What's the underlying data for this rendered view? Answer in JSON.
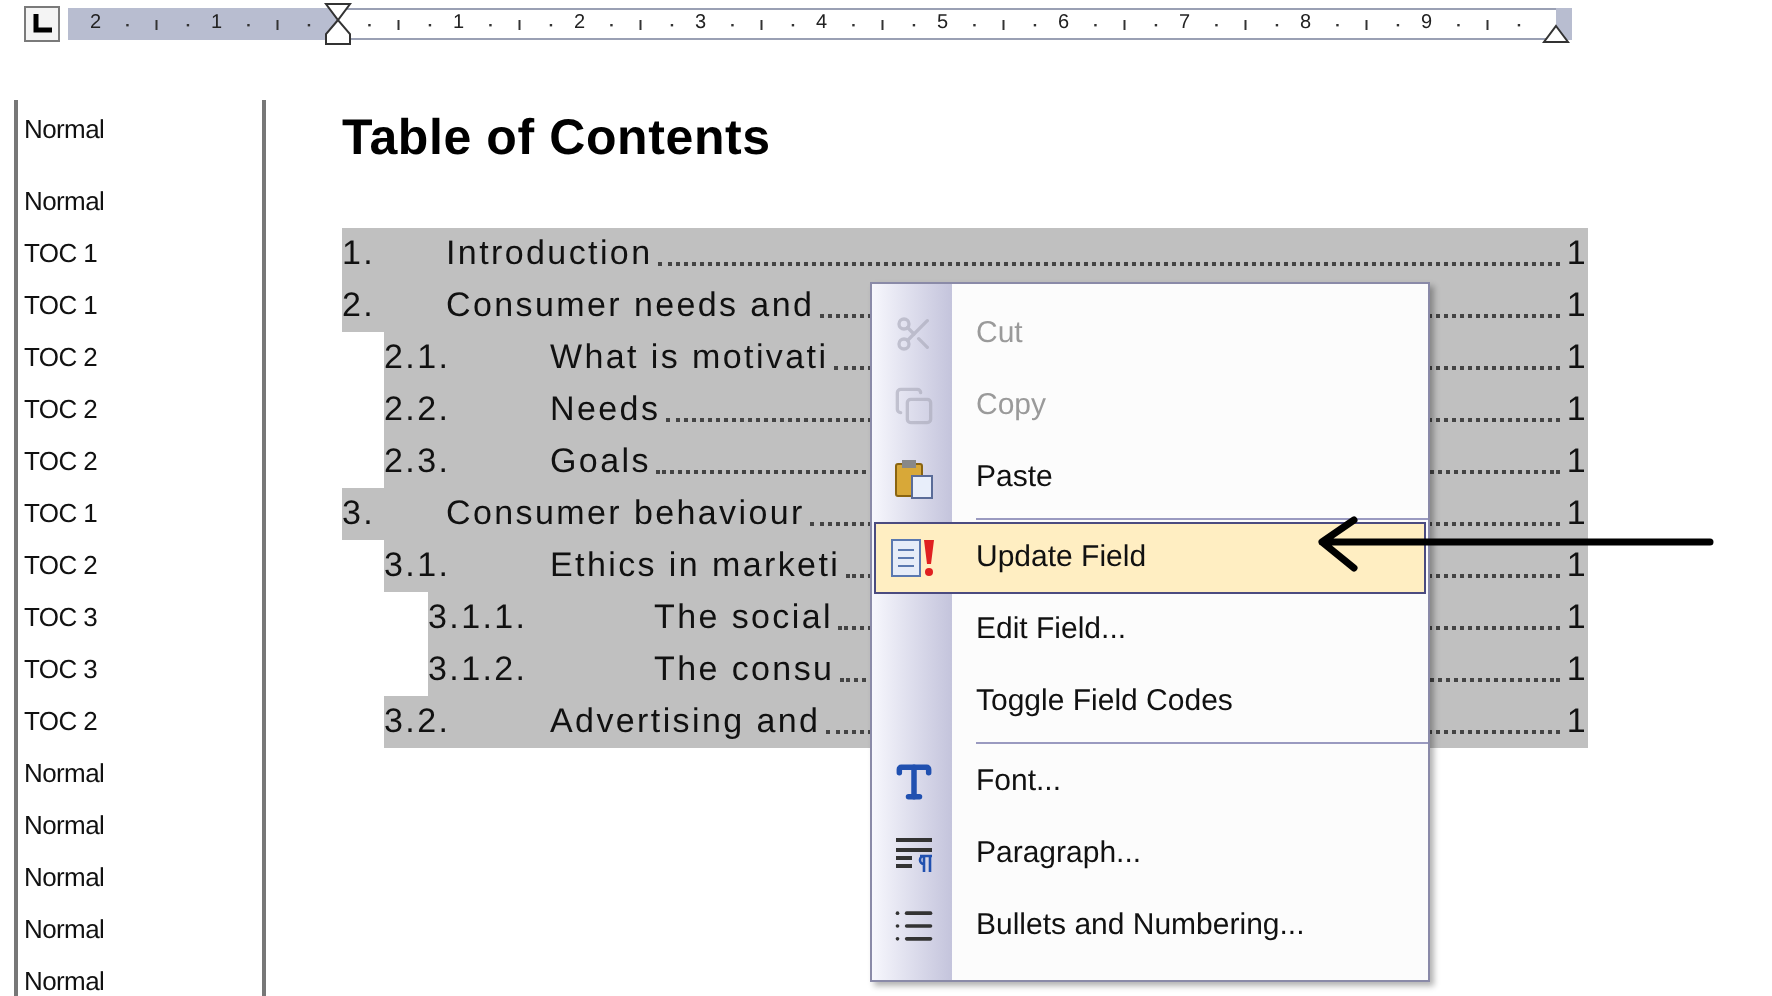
{
  "ruler": {
    "labels": [
      "2",
      "1",
      "1",
      "2",
      "3",
      "4",
      "5",
      "6",
      "7",
      "8",
      "9"
    ]
  },
  "style_area": {
    "items": [
      "Normal",
      "Normal",
      "TOC 1",
      "TOC 1",
      "TOC 2",
      "TOC 2",
      "TOC 2",
      "TOC 1",
      "TOC 2",
      "TOC 3",
      "TOC 3",
      "TOC 2",
      "Normal",
      "Normal",
      "Normal",
      "Normal",
      "Normal"
    ]
  },
  "document": {
    "title": "Table of Contents",
    "toc": [
      {
        "number": "1.",
        "text": "Introduction",
        "page": "1"
      },
      {
        "number": "2.",
        "text": "Consumer needs and",
        "page": "1",
        "children": [
          {
            "number": "2.1.",
            "text": "What is motivati",
            "page": "1"
          },
          {
            "number": "2.2.",
            "text": "Needs",
            "page": "1"
          },
          {
            "number": "2.3.",
            "text": "Goals",
            "page": "1"
          }
        ]
      },
      {
        "number": "3.",
        "text": "Consumer behaviour",
        "page": "1",
        "children": [
          {
            "number": "3.1.",
            "text": "Ethics in marketi",
            "page": "1",
            "children": [
              {
                "number": "3.1.1.",
                "text": "The social",
                "page": "1"
              },
              {
                "number": "3.1.2.",
                "text": "The consu",
                "page": "1"
              }
            ]
          },
          {
            "number": "3.2.",
            "text": "Advertising and",
            "page": "1"
          }
        ]
      }
    ]
  },
  "context_menu": {
    "items": [
      {
        "kind": "item",
        "label": "Cut",
        "disabled": true,
        "selected": false
      },
      {
        "kind": "item",
        "label": "Copy",
        "disabled": true,
        "selected": false
      },
      {
        "kind": "item",
        "label": "Paste",
        "disabled": false,
        "selected": false
      },
      {
        "kind": "separator"
      },
      {
        "kind": "item",
        "label": "Update Field",
        "disabled": false,
        "selected": true
      },
      {
        "kind": "item",
        "label": "Edit Field...",
        "disabled": false,
        "selected": false
      },
      {
        "kind": "item",
        "label": "Toggle Field Codes",
        "disabled": false,
        "selected": false
      },
      {
        "kind": "separator"
      },
      {
        "kind": "item",
        "label": "Font...",
        "disabled": false,
        "selected": false
      },
      {
        "kind": "item",
        "label": "Paragraph...",
        "disabled": false,
        "selected": false
      },
      {
        "kind": "item",
        "label": "Bullets and Numbering...",
        "disabled": false,
        "selected": false
      }
    ]
  }
}
